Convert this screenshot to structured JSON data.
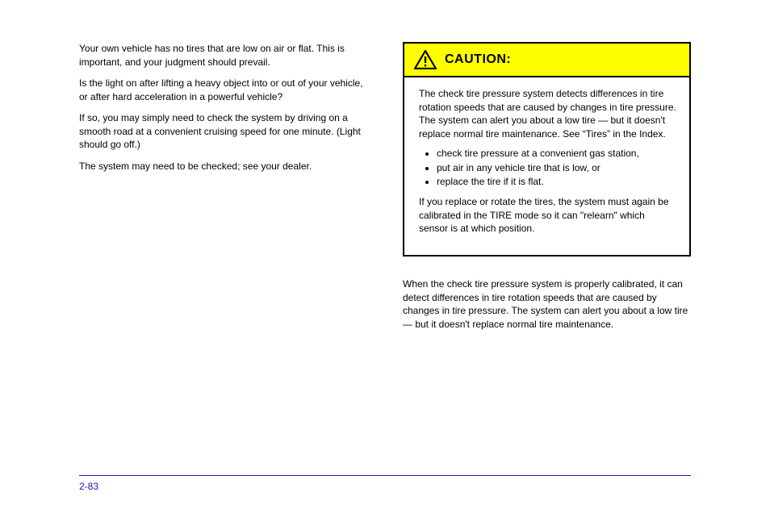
{
  "left": {
    "p1": "Your own vehicle has no tires that are low on air or flat. This is important, and your judgment should prevail.",
    "p2": "Is the light on after lifting a heavy object into or out of your vehicle, or after hard acceleration in a powerful vehicle?",
    "p3": "If so, you may simply need to check the system by driving on a smooth road at a convenient cruising speed for one minute. (Light should go off.)",
    "p4": "The system may need to be checked; see your dealer."
  },
  "caution": {
    "label": "CAUTION:",
    "lead": "The check tire pressure system detects differences in tire rotation speeds that are caused by changes in tire pressure. The system can alert you about a low tire — but it doesn't replace normal tire maintenance. See",
    "lead_quote": "Tires",
    "lead_tail": " in the Index.",
    "items": [
      "check tire pressure at a convenient gas station,",
      "put air in any vehicle tire that is low, or",
      "replace the tire if it is flat."
    ],
    "closing": "If you replace or rotate the tires, the system must again be calibrated in the TIRE mode so it can \"relearn\" which sensor is at which position."
  },
  "right": {
    "postCaution": "When the check tire pressure system is properly calibrated, it can detect differences in tire rotation speeds that are caused by changes in tire pressure. The system can alert you about a low tire — but it doesn't replace normal tire maintenance."
  },
  "footer": {
    "page": "2-83"
  }
}
